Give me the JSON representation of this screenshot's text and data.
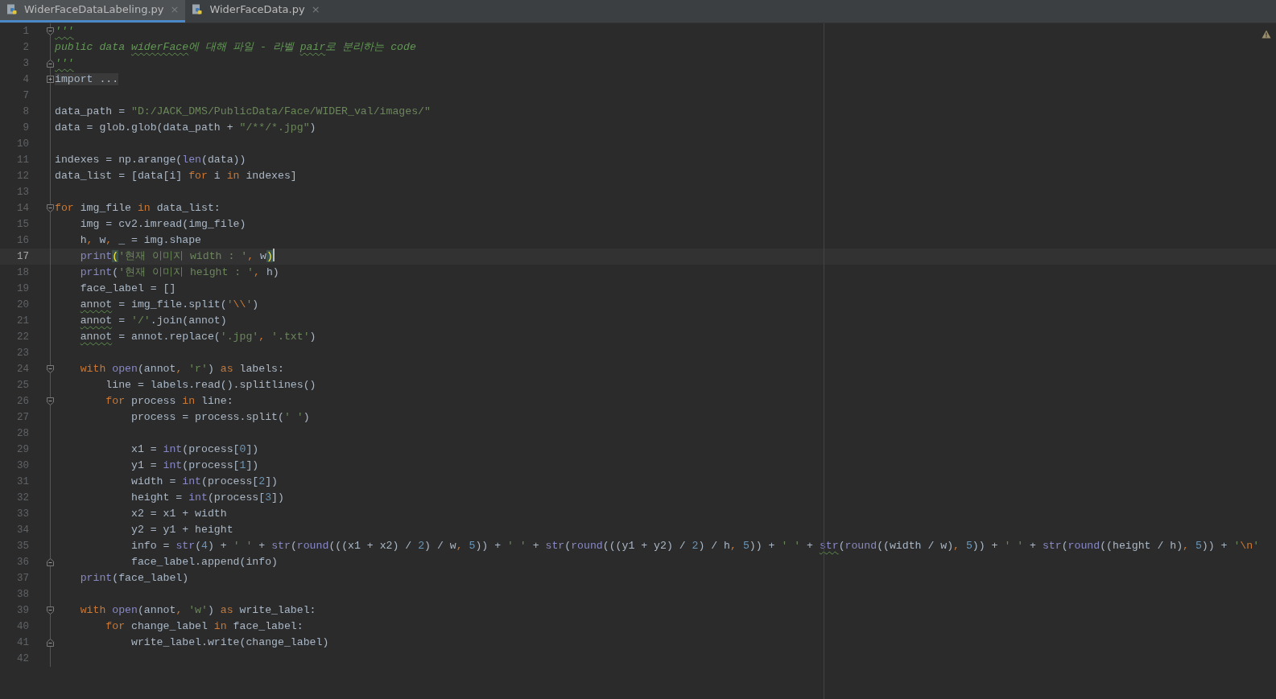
{
  "tabs": [
    {
      "label": "WiderFaceDataLabeling.py",
      "close": "×",
      "selected": true
    },
    {
      "label": "WiderFaceData.py",
      "close": "×",
      "selected": false
    }
  ],
  "editor": {
    "lines": [
      {
        "number": "1",
        "current": false,
        "kind": "fold-start",
        "tokens": [
          {
            "kind": "docstring-typo",
            "text": "'''"
          }
        ]
      },
      {
        "number": "2",
        "current": false,
        "tokens": [
          {
            "kind": "docstring",
            "text": "public data "
          },
          {
            "kind": "docstring-typo",
            "text": "widerFace"
          },
          {
            "kind": "docstring",
            "text": "에 대해 파일 - 라벨 "
          },
          {
            "kind": "docstring-typo",
            "text": "pair"
          },
          {
            "kind": "docstring",
            "text": "로 분리하는 code"
          }
        ]
      },
      {
        "number": "3",
        "current": false,
        "kind": "fold-end",
        "tokens": [
          {
            "kind": "docstring-typo",
            "text": "'''"
          }
        ]
      },
      {
        "number": "4",
        "current": false,
        "kind": "collapsed",
        "tokens": [
          {
            "kind": "folded",
            "text": "import ..."
          }
        ]
      },
      {
        "number": "7",
        "current": false
      },
      {
        "number": "8",
        "current": false,
        "tokens": [
          {
            "kind": "plain",
            "text": "data_path = "
          },
          {
            "kind": "string",
            "text": "\"D:/JACK_DMS/PublicData/Face/WIDER_val/images/\""
          }
        ]
      },
      {
        "number": "9",
        "current": false,
        "tokens": [
          {
            "kind": "plain",
            "text": "data = glob.glob(data_path + "
          },
          {
            "kind": "string",
            "text": "\"/**/*.jpg\""
          },
          {
            "kind": "plain",
            "text": ")"
          }
        ]
      },
      {
        "number": "10",
        "current": false
      },
      {
        "number": "11",
        "current": false,
        "tokens": [
          {
            "kind": "plain",
            "text": "indexes = np.arange("
          },
          {
            "kind": "builtin",
            "text": "len"
          },
          {
            "kind": "plain",
            "text": "(data))"
          }
        ]
      },
      {
        "number": "12",
        "current": false,
        "tokens": [
          {
            "kind": "plain",
            "text": "data_list = [data[i] "
          },
          {
            "kind": "keyword",
            "text": "for"
          },
          {
            "kind": "plain",
            "text": " i "
          },
          {
            "kind": "keyword",
            "text": "in"
          },
          {
            "kind": "plain",
            "text": " indexes]"
          }
        ]
      },
      {
        "number": "13",
        "current": false
      },
      {
        "number": "14",
        "current": false,
        "kind": "fold-start",
        "tokens": [
          {
            "kind": "keyword",
            "text": "for"
          },
          {
            "kind": "plain",
            "text": " img_file "
          },
          {
            "kind": "keyword",
            "text": "in"
          },
          {
            "kind": "plain",
            "text": " data_list:"
          }
        ]
      },
      {
        "number": "15",
        "current": false,
        "tokens": [
          {
            "kind": "plain",
            "text": "    img = cv2.imread(img_file)"
          }
        ]
      },
      {
        "number": "16",
        "current": false,
        "tokens": [
          {
            "kind": "plain",
            "text": "    h"
          },
          {
            "kind": "comma",
            "text": ", "
          },
          {
            "kind": "plain",
            "text": "w"
          },
          {
            "kind": "comma",
            "text": ", "
          },
          {
            "kind": "plain",
            "text": "_ = img.shape"
          }
        ]
      },
      {
        "number": "17",
        "current": true,
        "tokens": [
          {
            "kind": "builtin",
            "text": "    print"
          },
          {
            "kind": "brace-match",
            "text": "("
          },
          {
            "kind": "string",
            "text": "'현재 이미지 width : '"
          },
          {
            "kind": "comma",
            "text": ","
          },
          {
            "kind": "plain",
            "text": " w"
          },
          {
            "kind": "brace-match",
            "text": ")"
          }
        ]
      },
      {
        "number": "18",
        "current": false,
        "tokens": [
          {
            "kind": "builtin",
            "text": "    print"
          },
          {
            "kind": "plain",
            "text": "("
          },
          {
            "kind": "string",
            "text": "'현재 이미지 height : '"
          },
          {
            "kind": "comma",
            "text": ","
          },
          {
            "kind": "plain",
            "text": " h)"
          }
        ]
      },
      {
        "number": "19",
        "current": false,
        "tokens": [
          {
            "kind": "plain",
            "text": "    face_label = []"
          }
        ]
      },
      {
        "number": "20",
        "current": false,
        "tokens": [
          {
            "kind": "plain-typo",
            "text": "    annot"
          },
          {
            "kind": "plain",
            "text": " = img_file.split("
          },
          {
            "kind": "string",
            "text": "'"
          },
          {
            "kind": "escape",
            "text": "\\\\"
          },
          {
            "kind": "string",
            "text": "'"
          },
          {
            "kind": "plain",
            "text": ")"
          }
        ]
      },
      {
        "number": "21",
        "current": false,
        "tokens": [
          {
            "kind": "plain-typo",
            "text": "    annot"
          },
          {
            "kind": "plain",
            "text": " = "
          },
          {
            "kind": "string",
            "text": "'/'"
          },
          {
            "kind": "plain",
            "text": ".join(annot)"
          }
        ]
      },
      {
        "number": "22",
        "current": false,
        "tokens": [
          {
            "kind": "plain-typo",
            "text": "    annot"
          },
          {
            "kind": "plain",
            "text": " = annot.replace("
          },
          {
            "kind": "string",
            "text": "'.jpg'"
          },
          {
            "kind": "comma",
            "text": ", "
          },
          {
            "kind": "string",
            "text": "'.txt'"
          },
          {
            "kind": "plain",
            "text": ")"
          }
        ]
      },
      {
        "number": "23",
        "current": false
      },
      {
        "number": "24",
        "current": false,
        "kind": "fold-start",
        "tokens": [
          {
            "kind": "keyword",
            "text": "    with "
          },
          {
            "kind": "builtin",
            "text": "open"
          },
          {
            "kind": "plain",
            "text": "(annot"
          },
          {
            "kind": "comma",
            "text": ", "
          },
          {
            "kind": "string",
            "text": "'r'"
          },
          {
            "kind": "plain",
            "text": ") "
          },
          {
            "kind": "keyword",
            "text": "as"
          },
          {
            "kind": "plain",
            "text": " labels:"
          }
        ]
      },
      {
        "number": "25",
        "current": false,
        "tokens": [
          {
            "kind": "plain",
            "text": "        line = labels.read().splitlines()"
          }
        ]
      },
      {
        "number": "26",
        "current": false,
        "kind": "fold-start",
        "tokens": [
          {
            "kind": "keyword",
            "text": "        for"
          },
          {
            "kind": "plain",
            "text": " process "
          },
          {
            "kind": "keyword",
            "text": "in"
          },
          {
            "kind": "plain",
            "text": " line:"
          }
        ]
      },
      {
        "number": "27",
        "current": false,
        "tokens": [
          {
            "kind": "plain",
            "text": "            process = process.split("
          },
          {
            "kind": "string",
            "text": "' '"
          },
          {
            "kind": "plain",
            "text": ")"
          }
        ]
      },
      {
        "number": "28",
        "current": false
      },
      {
        "number": "29",
        "current": false,
        "tokens": [
          {
            "kind": "plain",
            "text": "            x1 = "
          },
          {
            "kind": "builtin",
            "text": "int"
          },
          {
            "kind": "plain",
            "text": "(process["
          },
          {
            "kind": "number",
            "text": "0"
          },
          {
            "kind": "plain",
            "text": "])"
          }
        ]
      },
      {
        "number": "30",
        "current": false,
        "tokens": [
          {
            "kind": "plain",
            "text": "            y1 = "
          },
          {
            "kind": "builtin",
            "text": "int"
          },
          {
            "kind": "plain",
            "text": "(process["
          },
          {
            "kind": "number",
            "text": "1"
          },
          {
            "kind": "plain",
            "text": "])"
          }
        ]
      },
      {
        "number": "31",
        "current": false,
        "tokens": [
          {
            "kind": "plain",
            "text": "            width = "
          },
          {
            "kind": "builtin",
            "text": "int"
          },
          {
            "kind": "plain",
            "text": "(process["
          },
          {
            "kind": "number",
            "text": "2"
          },
          {
            "kind": "plain",
            "text": "])"
          }
        ]
      },
      {
        "number": "32",
        "current": false,
        "tokens": [
          {
            "kind": "plain",
            "text": "            height = "
          },
          {
            "kind": "builtin",
            "text": "int"
          },
          {
            "kind": "plain",
            "text": "(process["
          },
          {
            "kind": "number",
            "text": "3"
          },
          {
            "kind": "plain",
            "text": "])"
          }
        ]
      },
      {
        "number": "33",
        "current": false,
        "tokens": [
          {
            "kind": "plain",
            "text": "            x2 = x1 + width"
          }
        ]
      },
      {
        "number": "34",
        "current": false,
        "tokens": [
          {
            "kind": "plain",
            "text": "            y2 = y1 + height"
          }
        ]
      },
      {
        "number": "35",
        "current": false,
        "tokens": [
          {
            "kind": "plain",
            "text": "            info = "
          },
          {
            "kind": "builtin",
            "text": "str"
          },
          {
            "kind": "plain",
            "text": "("
          },
          {
            "kind": "number",
            "text": "4"
          },
          {
            "kind": "plain",
            "text": ") + "
          },
          {
            "kind": "string",
            "text": "' '"
          },
          {
            "kind": "plain",
            "text": " + "
          },
          {
            "kind": "builtin",
            "text": "str"
          },
          {
            "kind": "plain",
            "text": "("
          },
          {
            "kind": "builtin",
            "text": "round"
          },
          {
            "kind": "plain",
            "text": "(((x1 + x2) / "
          },
          {
            "kind": "number",
            "text": "2"
          },
          {
            "kind": "plain",
            "text": ") / w"
          },
          {
            "kind": "comma",
            "text": ", "
          },
          {
            "kind": "number",
            "text": "5"
          },
          {
            "kind": "plain",
            "text": ")) + "
          },
          {
            "kind": "string",
            "text": "' '"
          },
          {
            "kind": "plain",
            "text": " + "
          },
          {
            "kind": "builtin",
            "text": "str"
          },
          {
            "kind": "plain",
            "text": "("
          },
          {
            "kind": "builtin",
            "text": "round"
          },
          {
            "kind": "plain",
            "text": "(((y1 + y2) / "
          },
          {
            "kind": "number",
            "text": "2"
          },
          {
            "kind": "plain",
            "text": ") / h"
          },
          {
            "kind": "comma",
            "text": ", "
          },
          {
            "kind": "number",
            "text": "5"
          },
          {
            "kind": "plain",
            "text": ")) + "
          },
          {
            "kind": "string",
            "text": "' '"
          },
          {
            "kind": "plain",
            "text": " + "
          },
          {
            "kind": "builtin-typo",
            "text": "str"
          },
          {
            "kind": "plain",
            "text": "("
          },
          {
            "kind": "builtin",
            "text": "round"
          },
          {
            "kind": "plain",
            "text": "((width / w)"
          },
          {
            "kind": "comma",
            "text": ", "
          },
          {
            "kind": "number",
            "text": "5"
          },
          {
            "kind": "plain",
            "text": ")) + "
          },
          {
            "kind": "string",
            "text": "' '"
          },
          {
            "kind": "plain",
            "text": " + "
          },
          {
            "kind": "builtin",
            "text": "str"
          },
          {
            "kind": "plain",
            "text": "("
          },
          {
            "kind": "builtin",
            "text": "round"
          },
          {
            "kind": "plain",
            "text": "((height / h)"
          },
          {
            "kind": "comma",
            "text": ", "
          },
          {
            "kind": "number",
            "text": "5"
          },
          {
            "kind": "plain",
            "text": ")) + "
          },
          {
            "kind": "string",
            "text": "'"
          },
          {
            "kind": "escape",
            "text": "\\n"
          },
          {
            "kind": "string",
            "text": "'"
          }
        ]
      },
      {
        "number": "36",
        "current": false,
        "kind": "fold-end",
        "tokens": [
          {
            "kind": "plain",
            "text": "            face_label.append(info)"
          }
        ]
      },
      {
        "number": "37",
        "current": false,
        "tokens": [
          {
            "kind": "builtin",
            "text": "    print"
          },
          {
            "kind": "plain",
            "text": "(face_label)"
          }
        ]
      },
      {
        "number": "38",
        "current": false
      },
      {
        "number": "39",
        "current": false,
        "kind": "fold-start",
        "tokens": [
          {
            "kind": "keyword",
            "text": "    with "
          },
          {
            "kind": "builtin",
            "text": "open"
          },
          {
            "kind": "plain",
            "text": "(annot"
          },
          {
            "kind": "comma",
            "text": ", "
          },
          {
            "kind": "string",
            "text": "'w'"
          },
          {
            "kind": "plain",
            "text": ") "
          },
          {
            "kind": "keyword",
            "text": "as"
          },
          {
            "kind": "plain",
            "text": " write_label:"
          }
        ]
      },
      {
        "number": "40",
        "current": false,
        "tokens": [
          {
            "kind": "keyword",
            "text": "        for"
          },
          {
            "kind": "plain",
            "text": " change_label "
          },
          {
            "kind": "keyword",
            "text": "in"
          },
          {
            "kind": "plain",
            "text": " face_label:"
          }
        ]
      },
      {
        "number": "41",
        "current": false,
        "kind": "fold-end",
        "tokens": [
          {
            "kind": "plain",
            "text": "            write_label.write(change_label)"
          }
        ]
      },
      {
        "number": "42",
        "current": false
      }
    ]
  }
}
